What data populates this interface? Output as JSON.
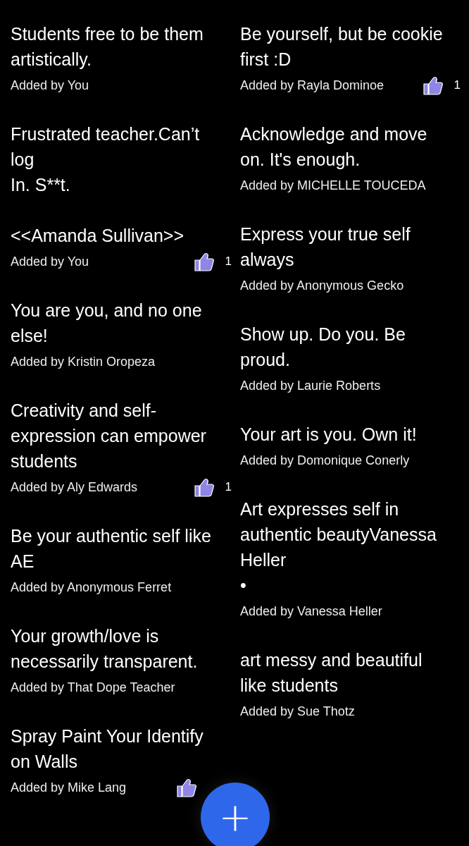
{
  "columns": [
    {
      "posts": [
        {
          "text": "Students free to be them artistically.",
          "author": "Added by You",
          "has_like": false
        },
        {
          "text": "Frustrated teacher.Can’t log\nIn. S**t.\n\n<<Amanda Sullivan>>",
          "author": "Added by You",
          "has_like": true,
          "likes": "1"
        },
        {
          "text": "You are you, and no one else!",
          "author": "Added by Kristin Oropeza",
          "has_like": false
        },
        {
          "text": "Creativity and self-expression can empower students",
          "author": "Added by Aly Edwards",
          "has_like": true,
          "likes": "1"
        },
        {
          "text": "Be your authentic self like AE",
          "author": "Added by Anonymous Ferret",
          "has_like": false
        },
        {
          "text": "Your growth/love is necessarily transparent.",
          "author": "Added by That Dope Teacher",
          "has_like": false
        },
        {
          "text": "Spray Paint Your Identify on Walls",
          "author": "Added by Mike Lang",
          "has_like": true
        }
      ]
    },
    {
      "posts": [
        {
          "text": "Be yourself, but be cookie first :D",
          "author": "Added by Rayla Dominoe",
          "has_like": true,
          "likes": "1"
        },
        {
          "text": "Acknowledge and move on. It's enough.\n",
          "author": "Added by MICHELLE TOUCEDA",
          "has_like": false
        },
        {
          "text": "Express your true self always",
          "author": "Added by Anonymous Gecko",
          "has_like": false
        },
        {
          "text": "Show up. Do you. Be proud.",
          "author": "Added by Laurie Roberts",
          "has_like": false
        },
        {
          "text": "Your art is you. Own it!",
          "author": "Added by Domonique Conerly",
          "has_like": false
        },
        {
          "text": "Art expresses self in authentic beautyVanessa Heller\n•\n",
          "author": "Added by Vanessa Heller",
          "has_like": false
        },
        {
          "text": "art messy and beautiful like students",
          "author": "Added by Sue Thotz",
          "has_like": false
        }
      ]
    }
  ],
  "add_button": {
    "label": "+"
  }
}
